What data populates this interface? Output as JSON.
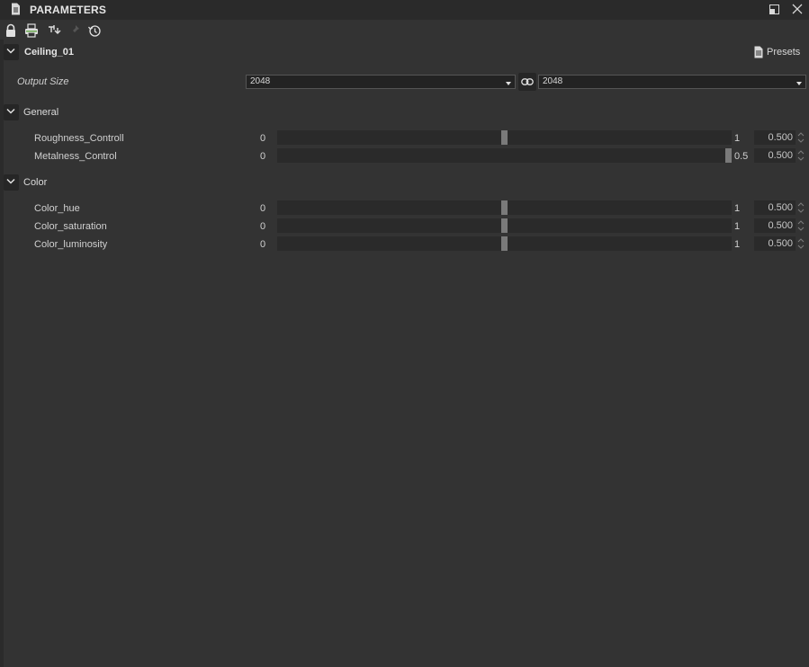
{
  "window": {
    "title": "PARAMETERS"
  },
  "graph": {
    "name": "Ceiling_01",
    "presets_label": "Presets"
  },
  "output_size": {
    "label": "Output Size",
    "width_value": "2048",
    "height_value": "2048"
  },
  "sections": {
    "general": {
      "title": "General",
      "params": [
        {
          "label": "Roughness_Controll",
          "min": "0",
          "max": "1",
          "value": "0.500",
          "fraction": 0.5
        },
        {
          "label": "Metalness_Control",
          "min": "0",
          "max": "0.5",
          "value": "0.500",
          "fraction": 1.0
        }
      ]
    },
    "color": {
      "title": "Color",
      "params": [
        {
          "label": "Color_hue",
          "min": "0",
          "max": "1",
          "value": "0.500",
          "fraction": 0.5
        },
        {
          "label": "Color_saturation",
          "min": "0",
          "max": "1",
          "value": "0.500",
          "fraction": 0.5
        },
        {
          "label": "Color_luminosity",
          "min": "0",
          "max": "1",
          "value": "0.500",
          "fraction": 0.5
        }
      ]
    }
  },
  "icons": {
    "title": "document-icon",
    "toolbar": [
      "lock-icon",
      "printer-icon",
      "pin-toggle-icon",
      "pin-icon",
      "reset-history-icon"
    ],
    "window": [
      "float-icon",
      "close-icon"
    ]
  },
  "colors": {
    "background": "#333333",
    "accent_green": "#6aa84f",
    "handle": "#7a7a7a"
  }
}
